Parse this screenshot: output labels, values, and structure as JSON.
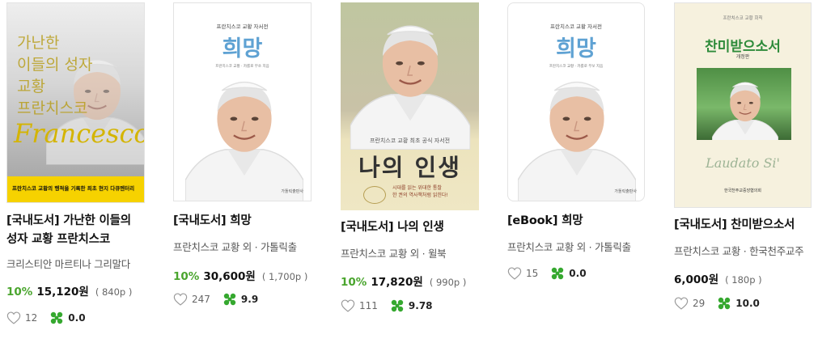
{
  "products": [
    {
      "title_line1": "[국내도서] 가난한 이들의",
      "title_line2": "성자 교황 프란치스코",
      "author": "크리스티안 마르티나 그리말다",
      "discount": "10%",
      "price": "15,120원",
      "points": "( 840p )",
      "likes": "12",
      "score": "0.0",
      "cover": {
        "title_lines": [
          "가난한",
          "이들의 성자",
          "교황",
          "프란치스코"
        ],
        "script": "Francesco",
        "band_text": "프란치스코 교황의 행적을 기록한 최초 현지 다큐멘터리"
      }
    },
    {
      "title_line1": "[국내도서] 희망",
      "author": "프란치스코 교황 외 · 가톨릭출",
      "discount": "10%",
      "price": "30,600원",
      "points": "( 1,700p )",
      "likes": "247",
      "score": "9.9",
      "cover": {
        "series": "프란치스코 교황 자서전",
        "title": "희망",
        "credits": "프란치스코 교황 · 카를로 무쏘 지음",
        "publisher": "가톨릭출판사"
      }
    },
    {
      "title_line1": "[국내도서] 나의 인생",
      "author": "프란치스코 교황 외 · 윌북",
      "discount": "10%",
      "price": "17,820원",
      "points": "( 990p )",
      "likes": "111",
      "score": "9.78",
      "cover": {
        "series": "프란치스코 교황 최초 공식 자서전",
        "title": "나의 인생",
        "quote_line1": "시대를 읽는 위대한 통찰",
        "quote_line2": "한 권의 역사책처럼 읽힌다!"
      }
    },
    {
      "title_line1": "[eBook] 희망",
      "author": "프란치스코 교황 외 · 가톨릭출",
      "price": "",
      "likes": "15",
      "score": "0.0",
      "cover": {
        "series": "프란치스코 교황 자서전",
        "title": "희망",
        "credits": "프란치스코 교황 · 카를로 무쏘 지음",
        "publisher": "가톨릭출판사"
      }
    },
    {
      "title_line1": "[국내도서] 찬미받으소서",
      "author": "프란치스코 교황 · 한국천주교주",
      "price": "6,000원",
      "points": "( 180p )",
      "likes": "29",
      "score": "10.0",
      "cover": {
        "series": "프란치스코 교황 회칙",
        "title": "찬미받으소서",
        "edition": "개정판",
        "latin": "Laudato Si'",
        "publisher": "한국천주교중앙협의회"
      }
    }
  ]
}
